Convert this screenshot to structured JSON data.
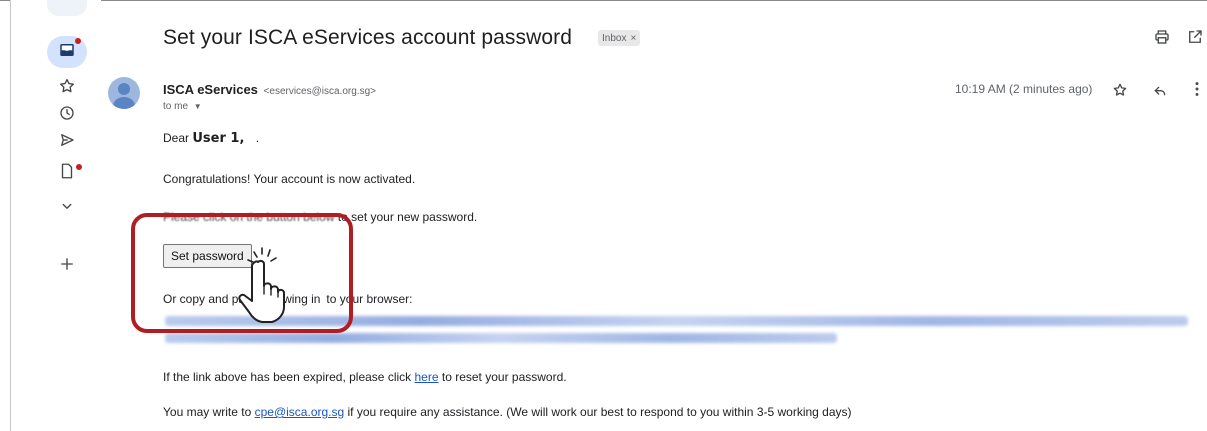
{
  "email": {
    "subject": "Set your ISCA eServices account password",
    "label_badge": "Inbox",
    "label_close": "×",
    "sender_name": "ISCA eServices",
    "sender_email": "<eservices@isca.org.sg>",
    "recipient": "to me",
    "timestamp": "10:19 AM (2 minutes ago)",
    "greeting_prefix": "Dear",
    "greeting_name": "User 1,",
    "greeting_suffix": ".",
    "line_activated": "Congratulations! Your account is now activated.",
    "line_click_prefix": "Please click on the button below",
    "line_click_suffix": "to set your new password.",
    "button_label": "Set password",
    "line_copy_prefix": "Or copy and pa",
    "line_copy_mid": "llowing in",
    "line_copy_suffix": "to your browser:",
    "line_expired_prefix": "If the link above has been expired, please click",
    "link_here": "here",
    "line_expired_suffix": "to reset your password.",
    "line_write_prefix": "You may write to",
    "link_email": "cpe@isca.org.sg",
    "line_write_suffix": "if you require any assistance. (We will work our best to respond to you within 3-5 working days)"
  },
  "icons": {
    "rail": [
      "inbox-icon",
      "star-icon",
      "clock-icon",
      "send-icon",
      "draft-icon",
      "chevron-down-icon",
      "plus-icon"
    ],
    "top": [
      "print-icon",
      "open-new-window-icon"
    ],
    "actions": [
      "star-icon",
      "reply-icon",
      "more-vert-icon"
    ]
  },
  "colors": {
    "highlight_border": "#b01e23",
    "link": "#1a55c4",
    "notification_dot": "#c5221f",
    "rail_active": "#d3e3fd"
  }
}
